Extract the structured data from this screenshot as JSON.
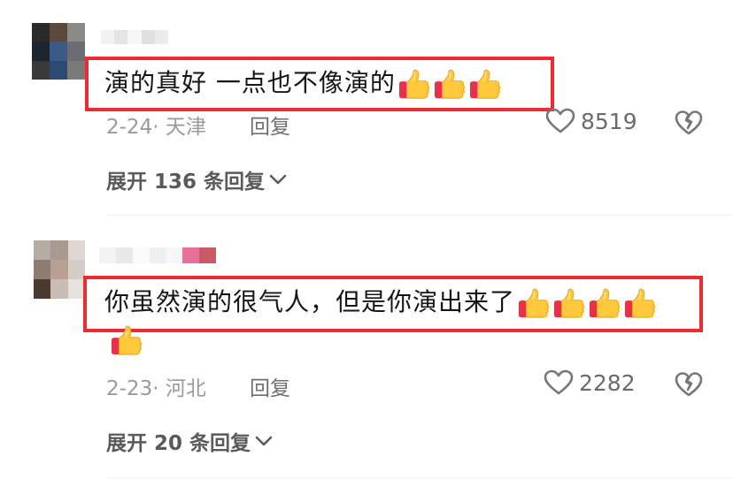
{
  "comments": [
    {
      "text": "演的真好 一点也不像演的",
      "thumbs_count": 3,
      "date_location": "2-24· 天津",
      "reply_label": "回复",
      "like_count": "8519",
      "expand_label": "展开 136 条回复"
    },
    {
      "text": "你虽然演的很气人，但是你演出来了",
      "thumbs_count": 5,
      "date_location": "2-23· 河北",
      "reply_label": "回复",
      "like_count": "2282",
      "expand_label": "展开 20 条回复"
    }
  ],
  "colors": {
    "highlight_border": "#ee2b33",
    "thumb_yellow": "#ffc83d",
    "thumb_red": "#e8304a"
  },
  "icons": {
    "thumb": "thumbs-up-emoji",
    "like": "heart-outline-icon",
    "dislike": "broken-heart-icon",
    "expand": "chevron-down-icon"
  }
}
